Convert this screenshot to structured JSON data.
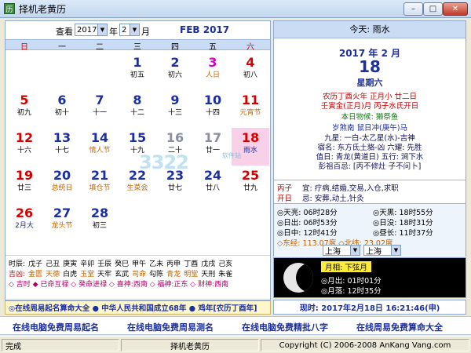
{
  "window": {
    "title": "择机老黄历",
    "icon_text": "历",
    "minimize": "–",
    "maximize": "□",
    "close": "✕"
  },
  "nav": {
    "label_view": "查看",
    "year": "2017",
    "label_year": "年",
    "month": "2",
    "label_month": "月",
    "month_title": "FEB 2017"
  },
  "weekdays": [
    "日",
    "一",
    "二",
    "三",
    "四",
    "五",
    "六"
  ],
  "days": [
    {
      "n": "",
      "s": ""
    },
    {
      "n": "",
      "s": ""
    },
    {
      "n": "",
      "s": ""
    },
    {
      "n": "1",
      "s": "初五"
    },
    {
      "n": "2",
      "s": "初六"
    },
    {
      "n": "3",
      "s": "人日",
      "nc": "mag",
      "sc": "fest"
    },
    {
      "n": "4",
      "s": "初八",
      "nc": "red"
    },
    {
      "n": "5",
      "s": "初九",
      "nc": "red"
    },
    {
      "n": "6",
      "s": "初十"
    },
    {
      "n": "7",
      "s": "十一"
    },
    {
      "n": "8",
      "s": "十二"
    },
    {
      "n": "9",
      "s": "十三"
    },
    {
      "n": "10",
      "s": "十四"
    },
    {
      "n": "11",
      "s": "元宵节",
      "nc": "red",
      "sc": "fest"
    },
    {
      "n": "12",
      "s": "十六",
      "nc": "red"
    },
    {
      "n": "13",
      "s": "十七"
    },
    {
      "n": "14",
      "s": "情人节",
      "sc": "fest"
    },
    {
      "n": "15",
      "s": "十九"
    },
    {
      "n": "16",
      "s": "二十",
      "nc": "gry"
    },
    {
      "n": "17",
      "s": "廿一",
      "nc": "gry"
    },
    {
      "n": "18",
      "s": "雨水",
      "nc": "red",
      "sc": "blue",
      "today": true
    },
    {
      "n": "19",
      "s": "廿三",
      "nc": "red"
    },
    {
      "n": "20",
      "s": "总统日",
      "sc": "fest"
    },
    {
      "n": "21",
      "s": "填仓节",
      "sc": "fest"
    },
    {
      "n": "22",
      "s": "生菜会",
      "sc": "fest"
    },
    {
      "n": "23",
      "s": "廿七"
    },
    {
      "n": "24",
      "s": "廿八"
    },
    {
      "n": "25",
      "s": "廿九",
      "nc": "red"
    },
    {
      "n": "26",
      "s": "2月大",
      "nc": "red",
      "sc": "blue"
    },
    {
      "n": "27",
      "s": "龙头节",
      "sc": "fest"
    },
    {
      "n": "28",
      "s": "初三"
    },
    {
      "n": "",
      "s": ""
    },
    {
      "n": "",
      "s": ""
    },
    {
      "n": "",
      "s": ""
    },
    {
      "n": "",
      "s": ""
    }
  ],
  "hours": {
    "label_hours": "时辰:",
    "hours_list": [
      "戊子",
      "己丑",
      "庚寅",
      "辛卯",
      "壬辰",
      "癸巳",
      "甲午",
      "乙未",
      "丙申",
      "丁酉",
      "戊戌",
      "己亥"
    ],
    "label_luck": "吉凶:",
    "luck_list": [
      "金匮",
      "天德",
      "白虎",
      "玉堂",
      "天牢",
      "玄武",
      "司命",
      "勾陈",
      "青龙",
      "明堂",
      "天刑",
      "朱雀"
    ],
    "legend": "◇ 吉时   ◆ 已命互禄   ◇ 癸命进禄   ◇ 喜神:西南   ◇ 福神:正东   ◇ 财神:西南"
  },
  "status_strip": "◎在线周易起名算命大全 ● 中华人民共和国成立68年 ● 鸡年[农历丁酉年]",
  "right": {
    "today_label": "今天: 雨水",
    "date_line": "2017 年 2 月",
    "day": "18",
    "weekday": "星期六",
    "lunar1": "农历丁酉火年  正月小  廿二日",
    "lunar2": "壬寅金(正月)月  丙子水氏开日",
    "solar_term": "本日物候: 獭祭鱼",
    "chong": "岁煞南  鼠日冲(庚午)马",
    "star1": "九星: 一白-太乙星(水)-吉神",
    "star2": "宿名: 东方氐土貉-凶  六耀: 先胜",
    "star3": "值日: 青龙(黄道日)  五行: 涧下水",
    "star4": "彭祖百忌: [丙不修灶  子不问卜]",
    "yi_label": "丙子",
    "yi": "宜: 疗病,结婚,交易,入仓,求职",
    "ji_label": "开日",
    "ji": "忌: 安葬,动土,针灸",
    "sun": [
      [
        "◎天亮: 06时28分",
        "◎天黑: 18时55分"
      ],
      [
        "◎日出: 06时53分",
        "◎日没: 18时31分"
      ],
      [
        "◎日中: 12时41分",
        "◎昼长: 11时37分"
      ]
    ],
    "coords": "◇东经: 113.07度  ◇北纬: 23.02度",
    "city1": "上海",
    "city2": "上海"
  },
  "moon": {
    "phase": "月相: 下弦月",
    "rise": "◎月出: 01时01分",
    "set": "◎月落: 12时35分"
  },
  "now": "现时: 2017年2月18日  16:21:46(申)",
  "links": [
    "在线电脑免费周易起名",
    "在线电脑免费周易测名",
    "在线电脑免费精批八字",
    "在线周易免费算命大全"
  ],
  "statusbar": {
    "left": "完成",
    "mid": "择机老黄历",
    "right": "Copyright (C) 2006-2008 AnKang Vang.com"
  },
  "watermark": {
    "text": "3322",
    "sub": "软件站"
  }
}
